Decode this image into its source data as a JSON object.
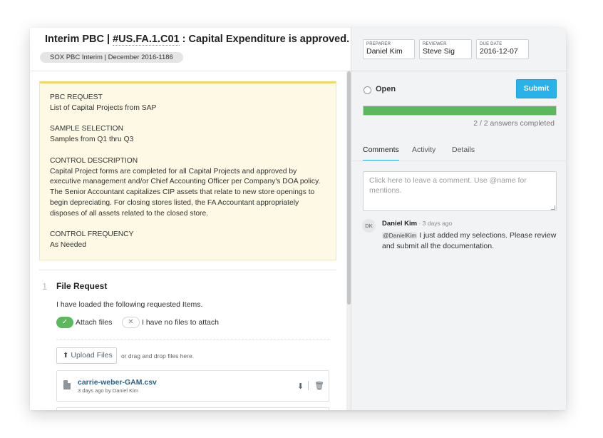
{
  "header": {
    "title_prefix": "Interim PBC | ",
    "title_code": "#US.FA.1.C01",
    "title_suffix": " : Capital Expenditure is approved.",
    "subtitle": "SOX PBC Interim | December 2016-1186"
  },
  "request_card": {
    "sections": [
      {
        "label": "PBC REQUEST",
        "text": "List of Capital Projects from SAP"
      },
      {
        "label": "SAMPLE SELECTION",
        "text": "Samples from Q1 thru Q3"
      },
      {
        "label": "CONTROL DESCRIPTION",
        "text": "Capital Project forms are completed for all Capital Projects and approved by executive management and/or Chief Accounting Officer per Company's DOA policy. The Senior Accountant capitalizes CIP assets that relate to new store openings to begin depreciating. For closing stores listed, the FA Accountant appropriately disposes of all assets related to the closed store."
      },
      {
        "label": "CONTROL FREQUENCY",
        "text": "As Needed"
      }
    ]
  },
  "question": {
    "number": "1",
    "title": "File Request",
    "text": "I have loaded the following requested Items.",
    "option_attach": "Attach files",
    "option_none": "I have no files to attach",
    "upload_label": "Upload Files",
    "drop_hint": "or drag and drop files here.",
    "file": {
      "name": "carrie-weber-GAM.csv",
      "meta": "3 days ago by Daniel Kim"
    }
  },
  "fields": {
    "preparer_label": "PREPARER",
    "preparer_value": "Daniel Kim",
    "reviewer_label": "REVIEWER",
    "reviewer_value": "Steve Sig",
    "due_label": "DUE DATE",
    "due_value": "2016-12-07"
  },
  "status": {
    "label": "Open",
    "submit_label": "Submit",
    "progress_fraction": 1.0,
    "answers_text": "2 / 2 answers completed"
  },
  "tabs": [
    {
      "label": "Comments",
      "active": true
    },
    {
      "label": "Activity",
      "active": false
    },
    {
      "label": "Details",
      "active": false
    }
  ],
  "comments": {
    "placeholder": "Click here to leave a comment. Use @name for mentions.",
    "items": [
      {
        "initials": "DK",
        "author": "Daniel Kim",
        "time": " · 3 days ago",
        "mention": "@DanielKim",
        "body": " I just added my selections. Please review and submit all the documentation."
      }
    ]
  },
  "colors": {
    "accent": "#29b1ea",
    "success": "#5cb85c",
    "card_bg": "#fdf9e4",
    "card_top": "#f2d86a",
    "link": "#2f5e83"
  }
}
